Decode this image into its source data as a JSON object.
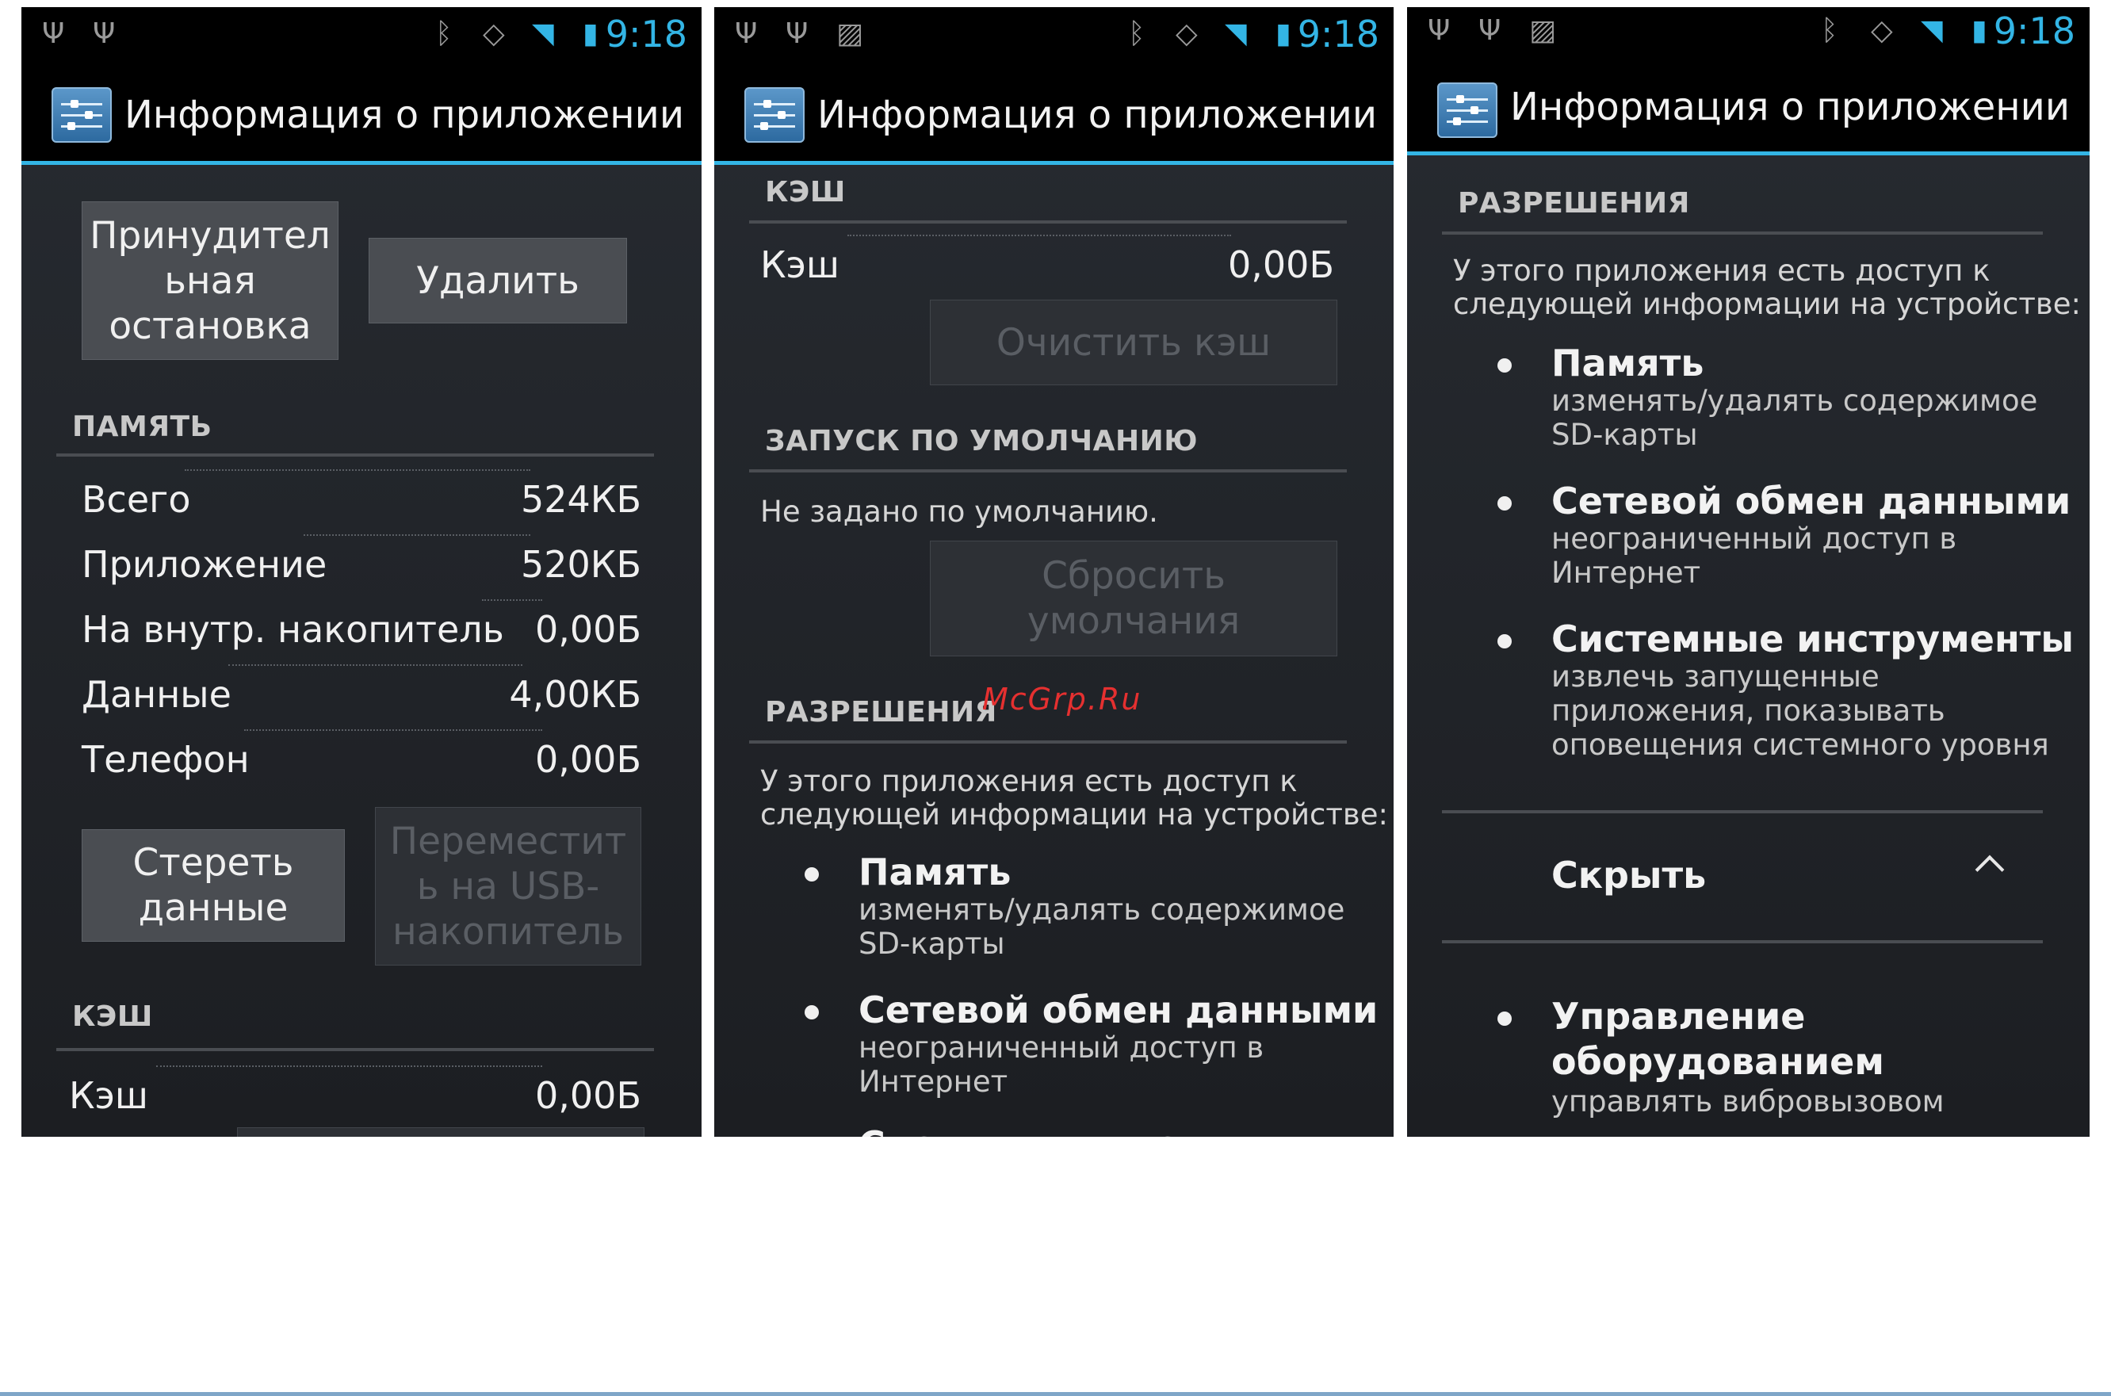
{
  "status_bar": {
    "time": "9:18",
    "icons": [
      "usb-icon",
      "usb-icon",
      "image-icon",
      "bluetooth-icon",
      "vibrate-icon",
      "wifi-icon",
      "battery-charging-icon"
    ]
  },
  "app_bar_title": "Информация о приложении",
  "watermark": "McGrp.Ru",
  "screen1": {
    "force_stop_label": "Принудител\nьная\nостановка",
    "uninstall_label": "Удалить",
    "memory_header": "ПАМЯТЬ",
    "memory_rows": [
      {
        "label": "Всего",
        "value": "524КБ"
      },
      {
        "label": "Приложение",
        "value": "520КБ"
      },
      {
        "label": "На внутр. накопитель",
        "value": "0,00Б"
      },
      {
        "label": "Данные",
        "value": "4,00КБ"
      },
      {
        "label": "Телефон",
        "value": "0,00Б"
      }
    ],
    "clear_data_label": "Стереть\nданные",
    "move_usb_label": "Переместит\nь на USB-\nнакопитель",
    "cache_header": "КЭШ",
    "cache_row": {
      "label": "Кэш",
      "value": "0,00Б"
    }
  },
  "screen2": {
    "cache_header": "КЭШ",
    "cache_row": {
      "label": "Кэш",
      "value": "0,00Б"
    },
    "clear_cache_label": "Очистить кэш",
    "launch_default_header": "ЗАПУСК ПО УМОЛЧАНИЮ",
    "no_defaults_text": "Не задано по умолчанию.",
    "reset_defaults_label": "Сбросить\nумолчания",
    "permissions_header": "РАЗРЕШЕНИЯ",
    "permissions_intro_1": "У этого приложения есть доступ к",
    "permissions_intro_2": "следующей информации на устройстве:",
    "permissions": [
      {
        "title": "Память",
        "desc_1": "изменять/удалять содержимое",
        "desc_2": "SD-карты"
      },
      {
        "title": "Сетевой обмен данными",
        "desc_1": "неограниченный доступ в",
        "desc_2": "Интернет"
      },
      {
        "title": "Системные инструменты",
        "desc_1": "",
        "desc_2": ""
      }
    ]
  },
  "screen3": {
    "permissions_header": "РАЗРЕШЕНИЯ",
    "permissions_intro_1": "У этого приложения есть доступ к",
    "permissions_intro_2": "следующей информации на устройстве:",
    "permissions": [
      {
        "title": "Память",
        "desc": [
          "изменять/удалять содержимое",
          "SD-карты"
        ]
      },
      {
        "title": "Сетевой обмен данными",
        "desc": [
          "неограниченный доступ в",
          "Интернет"
        ]
      },
      {
        "title": "Системные инструменты",
        "desc": [
          "извлечь запущенные",
          "приложения, показывать",
          "оповещения системного уровня"
        ]
      }
    ],
    "hide_label": "Скрыть",
    "hidden_permission": {
      "title_1": "Управление",
      "title_2": "оборудованием",
      "desc": "управлять вибровызовом"
    }
  }
}
